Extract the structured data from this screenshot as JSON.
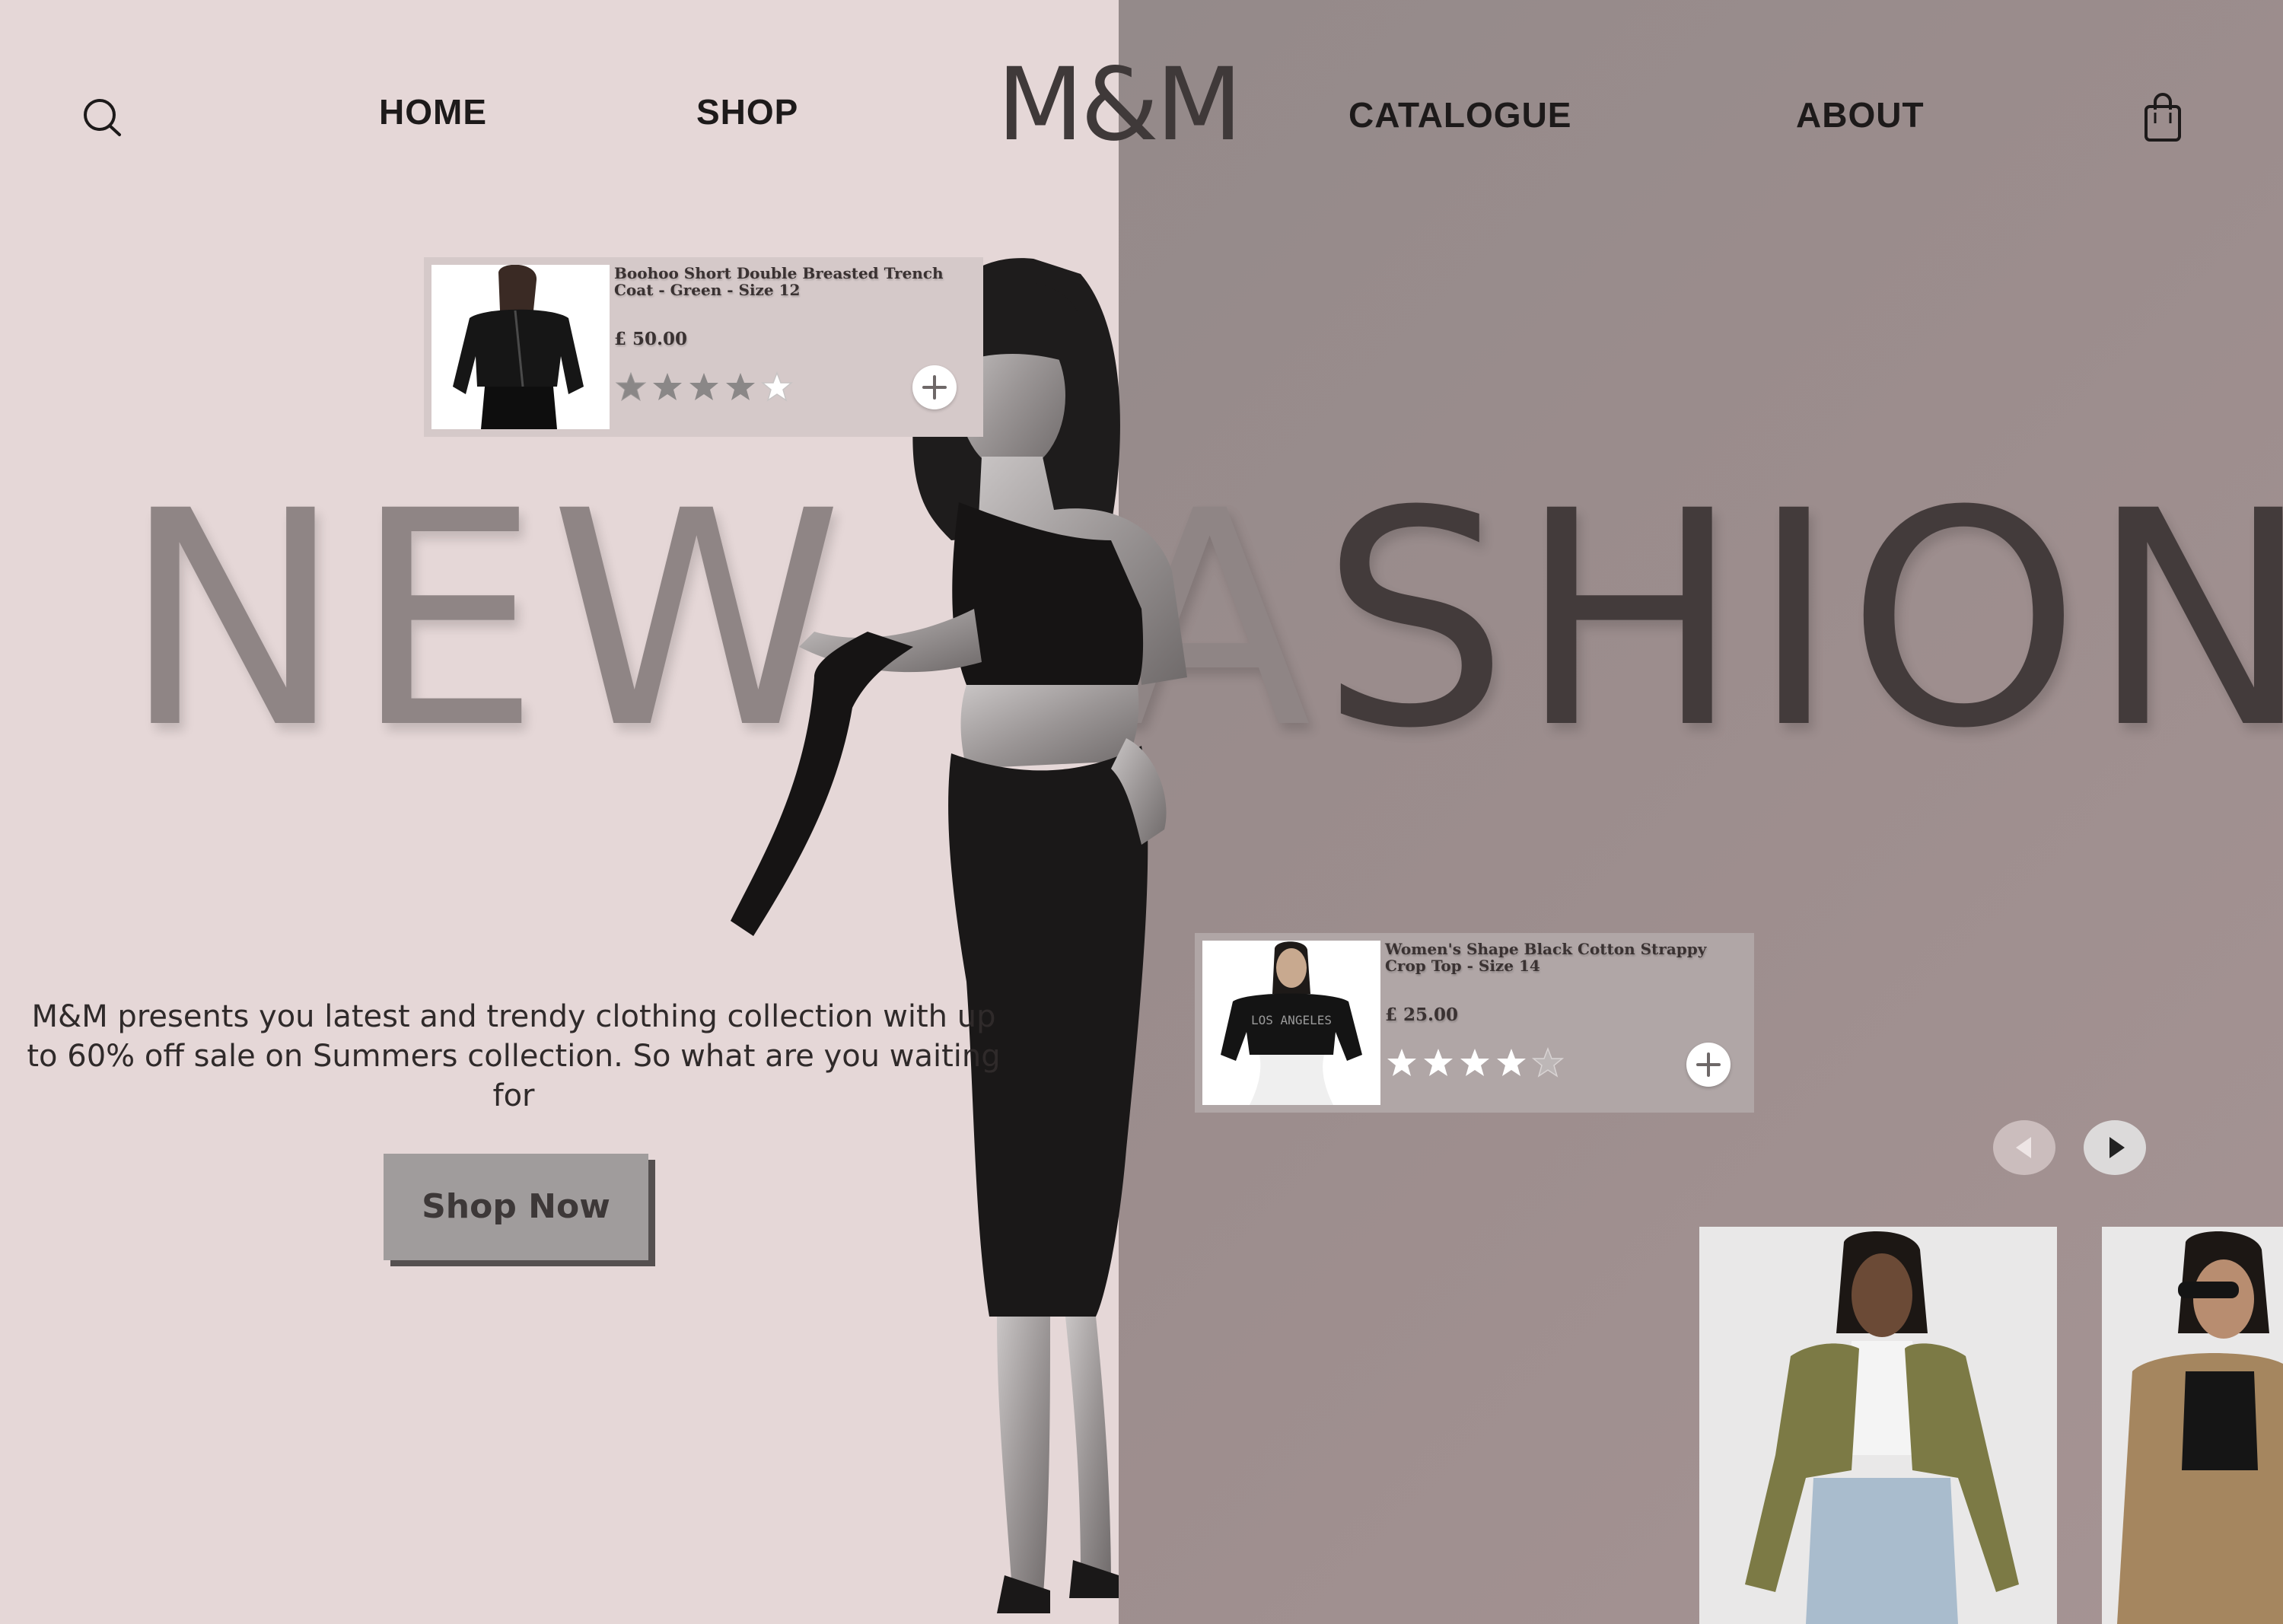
{
  "brand": {
    "logo": "M&M"
  },
  "nav": {
    "home": "HOME",
    "shop": "SHOP",
    "catalogue": "CATALOGUE",
    "about": "ABOUT",
    "search_icon": "search-icon",
    "cart_icon": "shopping-bag-icon"
  },
  "hero": {
    "title_light": "NEW FA",
    "title_dark": "SHION",
    "description": "M&M presents you latest and trendy clothing collection with up to 60% off sale on Summers collection. So what are you waiting for",
    "cta": "Shop Now"
  },
  "products": [
    {
      "title": "Boohoo Short Double Breasted Trench Coat - Green - Size 12",
      "price": "£ 50.00",
      "rating": 4,
      "rating_max": 5,
      "add_icon": "plus-icon"
    },
    {
      "title": "Women's Shape Black Cotton Strappy Crop Top - Size 14",
      "price": "£ 25.00",
      "rating": 4,
      "rating_max": 5,
      "add_icon": "plus-icon"
    }
  ],
  "carousel": {
    "prev_icon": "arrow-left-icon",
    "next_icon": "arrow-right-icon"
  },
  "colors": {
    "left_bg": "#e5d7d7",
    "right_bg": "#9c8d8d",
    "title_light": "#8f8585",
    "title_dark": "#433b3b",
    "cta_bg": "#a09c9c"
  }
}
